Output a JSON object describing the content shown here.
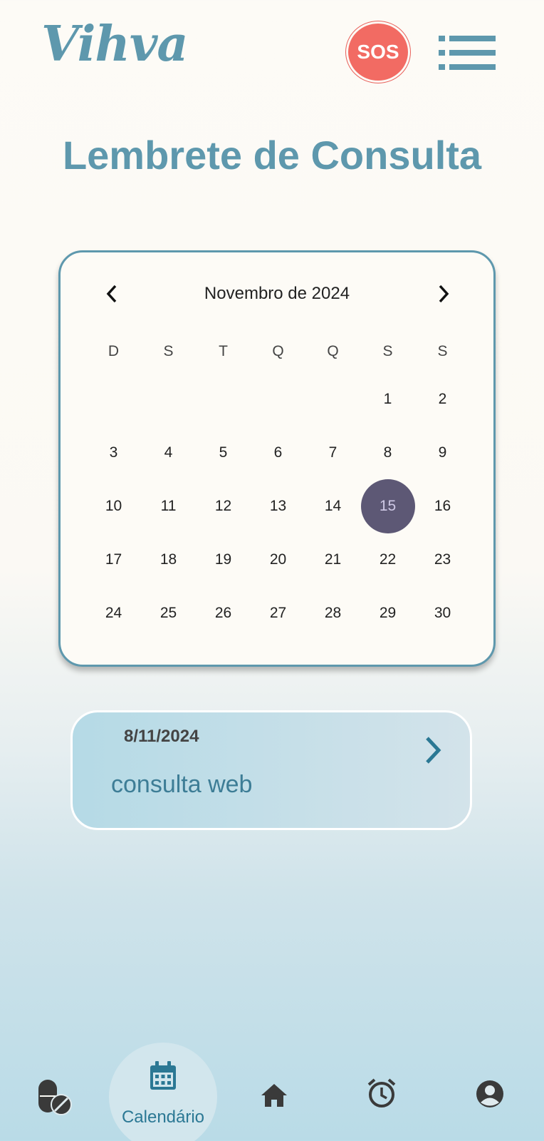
{
  "header": {
    "logo_text": "Vihva",
    "sos_label": "SOS"
  },
  "page": {
    "title": "Lembrete de Consulta"
  },
  "calendar": {
    "month_label": "Novembro de 2024",
    "weekdays": [
      "D",
      "S",
      "T",
      "Q",
      "Q",
      "S",
      "S"
    ],
    "leading_blanks": 5,
    "days": [
      "1",
      "2",
      "3",
      "4",
      "5",
      "6",
      "7",
      "8",
      "9",
      "10",
      "11",
      "12",
      "13",
      "14",
      "15",
      "16",
      "17",
      "18",
      "19",
      "20",
      "21",
      "22",
      "23",
      "24",
      "25",
      "26",
      "27",
      "28",
      "29",
      "30"
    ],
    "selected_day": "15"
  },
  "appointment": {
    "date": "8/11/2024",
    "title": "consulta web"
  },
  "nav": {
    "items": [
      {
        "icon": "pill-icon",
        "label": ""
      },
      {
        "icon": "calendar-icon",
        "label": "Calendário"
      },
      {
        "icon": "home-icon",
        "label": ""
      },
      {
        "icon": "alarm-clock-icon",
        "label": ""
      },
      {
        "icon": "account-icon",
        "label": ""
      }
    ],
    "active_label": "Calendário"
  },
  "colors": {
    "brand": "#5e98ad",
    "sos": "#f26b63",
    "selected_day": "#5d5875",
    "nav_active_bg": "#d2e6ed"
  }
}
